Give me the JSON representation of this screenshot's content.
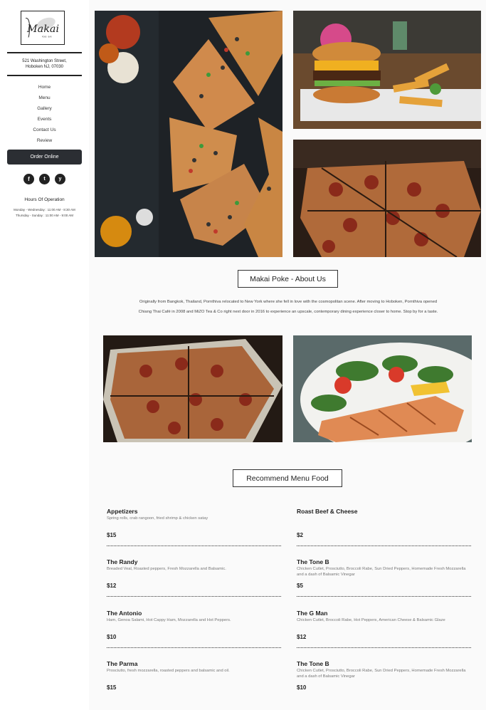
{
  "brand": {
    "logo_text": "Makai",
    "logo_sub": "POKE · BAR"
  },
  "address": {
    "line1": "521 Washington Street,",
    "line2": "Hoboken NJ, 07030"
  },
  "nav": [
    "Home",
    "Menu",
    "Gallery",
    "Events",
    "Contact Us",
    "Review"
  ],
  "order_button": "Order Online",
  "social_icons": [
    "facebook-icon",
    "twitter-icon",
    "yelp-icon"
  ],
  "hours": {
    "title": "Hours Of Operation",
    "line1": "Monday - Wednesday : 11:00 AM - 8:30 AM",
    "line2": "Thursday - Sunday : 11:00 AM - 9:00 AM"
  },
  "about": {
    "title": "Makai Poke - About Us",
    "text": "Originally from Bangkok, Thailand, Pornthiva relocated to New York where she fell in love with the cosmopolitan scene. After moving to Hoboken, Pornthiva opened Chiang Thai Café in 2008 and MiZO Tea & Co right next door in 2016 to experience an upscale, contemporary dining experience closer to home. Stop by for a taste."
  },
  "menu": {
    "title": "Recommend Menu Food",
    "left": [
      {
        "name": "Appetizers",
        "desc": "Spring rolls, crab rangoon, fried shrimp & chicken satay",
        "price": "$15"
      },
      {
        "name": "The Randy",
        "desc": "Breaded Veal, Roasted peppers, Fresh Mozzarella and Balsamic.",
        "price": "$12"
      },
      {
        "name": "The Antonio",
        "desc": "Ham, Genoa Salami, Hot Cappy Ham, Mozzarella and Hot Peppers.",
        "price": "$10"
      },
      {
        "name": "The Parma",
        "desc": "Prosciutto, fresh mozzarella, roasted peppers and balsamic and oil.",
        "price": "$15"
      }
    ],
    "right": [
      {
        "name": "Roast Beef & Cheese",
        "desc": "",
        "price": "$2"
      },
      {
        "name": "The Tone B",
        "desc": "Chicken Cutlet, Prosciutto, Broccoli Rabe, Sun Dried Peppers, Homemade Fresh Mozzarella and a dash of Balsamic Vinegar",
        "price": "$5"
      },
      {
        "name": "The G Man",
        "desc": "Chicken Cutlet, Broccoli Rabe, Hot Peppers, American Cheese & Balsamic Glaze",
        "price": "$12"
      },
      {
        "name": "The Tone B",
        "desc": "Chicken Cutlet, Prosciutto, Broccoli Rabe, Sun Dried Peppers, Homemade Fresh Mozzarella and a dash of Balsamic Vinegar",
        "price": "$10"
      }
    ]
  },
  "colors": {
    "button_bg": "#2b2e33",
    "text": "#222222",
    "page_bg": "#fafafa"
  }
}
